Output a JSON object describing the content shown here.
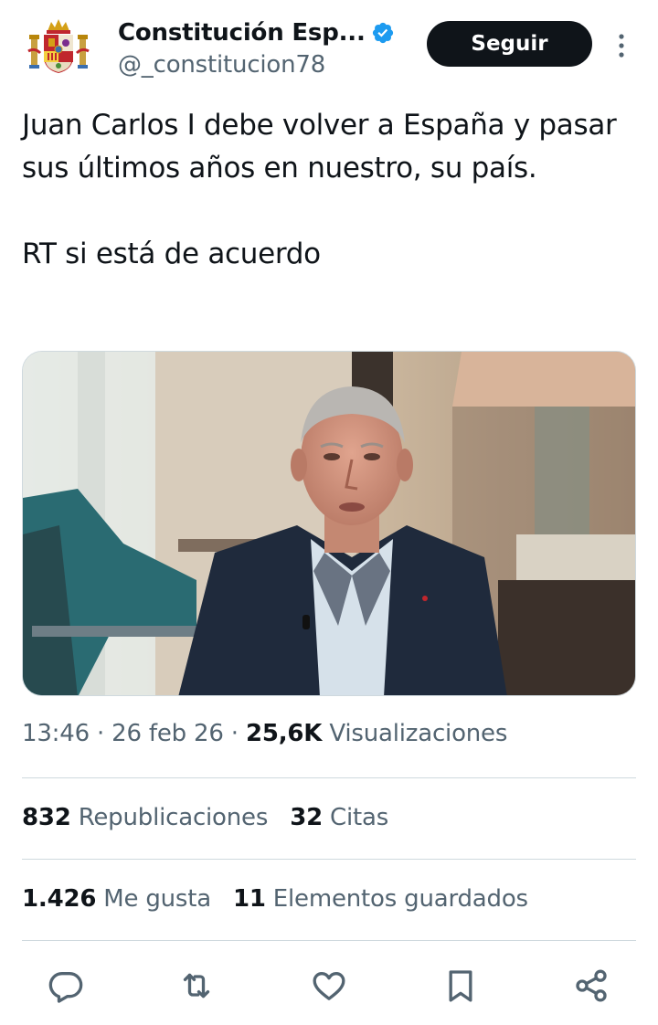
{
  "author": {
    "display_name": "Constitución Esp...",
    "handle": "@_constitucion78",
    "verified": true,
    "avatar_icon": "spain-coat-of-arms-icon"
  },
  "follow_label": "Seguir",
  "tweet": {
    "line1": "Juan Carlos I debe volver a España y pasar sus últimos años en nuestro, su país.",
    "line2": "RT si está de acuerdo"
  },
  "meta": {
    "time": "13:46",
    "date": "26 feb 26",
    "views_count": "25,6K",
    "views_label": "Visualizaciones"
  },
  "stats": {
    "reposts_count": "832",
    "reposts_label": "Republicaciones",
    "quotes_count": "32",
    "quotes_label": "Citas",
    "likes_count": "1.426",
    "likes_label": "Me gusta",
    "bookmarks_count": "11",
    "bookmarks_label": "Elementos guardados"
  },
  "colors": {
    "text": "#0f1419",
    "secondary": "#536471",
    "verified": "#1d9bf0",
    "divider": "#cfd9de"
  }
}
